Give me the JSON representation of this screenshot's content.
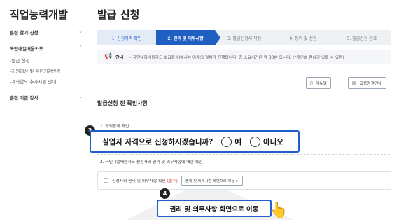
{
  "sidebar": {
    "title": "직업능력개발",
    "sections": [
      {
        "label": "훈련 찾기·신청"
      },
      {
        "label": "국민내일배움카드"
      },
      {
        "label": "훈련 기관·강사"
      }
    ],
    "sub_items": [
      {
        "label": "-발급 신청"
      },
      {
        "label": "-지원대상 및 훈련기관변경"
      },
      {
        "label": "-계좌한도 추가지원 안내"
      }
    ]
  },
  "page": {
    "title": "발급 신청"
  },
  "stepper": {
    "steps": [
      {
        "label": "1. 신청자격 확인"
      },
      {
        "label": "2. 권리 및 의무사항"
      },
      {
        "label": "3. 발급신청서 작성"
      },
      {
        "label": "4. 동의 및 신청"
      },
      {
        "label": "5. 발급신청 완료"
      }
    ],
    "active_index": 1
  },
  "notice": {
    "label": "안내",
    "text": "• 국민내일배움카드 발급을 위해서는 아래의 절차가 진행됩니다. 총 소요시간은 약 30분 입니다. (*개인별 편차가 있을 수 있음)"
  },
  "buttons": {
    "manual": "매뉴얼",
    "policy": "고용정책안내"
  },
  "section": {
    "title": "발급신청 전 확인사항"
  },
  "questions": {
    "q1_label": "1. 구직등록 확인",
    "q1_question": "실업자 자격으로 신청하시겠습니까?",
    "yes": "예",
    "no": "아니오",
    "q2_label": "2. 국민내일배움카드 신청자의 권리 및 의무사항에 대한 확인"
  },
  "rights": {
    "label": "신청자의 권리 및 의무사항 확인",
    "required": "(필수)",
    "button": "권리 및 의무사항 화면으로 이동 >"
  },
  "callouts": {
    "badge_3": "3",
    "badge_4": "4",
    "move_text": "권리 및 의무사항 화면으로 이동"
  },
  "icons": {
    "megaphone": "megaphone-icon",
    "manual": "book-icon",
    "policy": "document-icon",
    "hand": "pointing-hand-icon",
    "chevron": "chevron-down-icon"
  },
  "colors": {
    "accent": "#1f5fc2",
    "highlight_border": "#1e5fd0",
    "required": "#d33333",
    "notice_icon": "#1f8a5e"
  }
}
